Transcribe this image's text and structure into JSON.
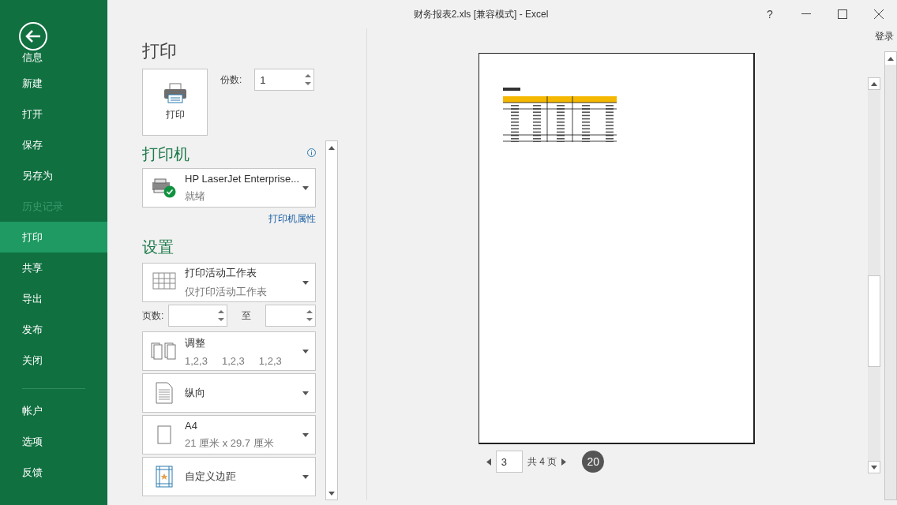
{
  "window": {
    "title": "财务报表2.xls  [兼容模式] - Excel",
    "help": "?",
    "sign_in": "登录"
  },
  "sidebar": {
    "items": [
      {
        "label": "信息",
        "selected": false,
        "disabled": false
      },
      {
        "label": "新建",
        "selected": false,
        "disabled": false
      },
      {
        "label": "打开",
        "selected": false,
        "disabled": false
      },
      {
        "label": "保存",
        "selected": false,
        "disabled": false
      },
      {
        "label": "另存为",
        "selected": false,
        "disabled": false
      },
      {
        "label": "历史记录",
        "selected": false,
        "disabled": true
      },
      {
        "label": "打印",
        "selected": true,
        "disabled": false
      },
      {
        "label": "共享",
        "selected": false,
        "disabled": false
      },
      {
        "label": "导出",
        "selected": false,
        "disabled": false
      },
      {
        "label": "发布",
        "selected": false,
        "disabled": false
      },
      {
        "label": "关闭",
        "selected": false,
        "disabled": false
      }
    ],
    "footer_items": [
      {
        "label": "帐户",
        "selected": false,
        "disabled": false
      },
      {
        "label": "选项",
        "selected": false,
        "disabled": false
      },
      {
        "label": "反馈",
        "selected": false,
        "disabled": false
      }
    ]
  },
  "print": {
    "heading": "打印",
    "button": "打印",
    "copies_label": "份数:",
    "copies": "1"
  },
  "printer": {
    "heading": "打印机",
    "name": "HP LaserJet Enterprise...",
    "status": "就绪",
    "properties_link": "打印机属性"
  },
  "settings": {
    "heading": "设置",
    "options": [
      {
        "kind": "sheet",
        "title": "打印活动工作表",
        "details": [
          "仅打印活动工作表"
        ]
      },
      {
        "kind": "pages",
        "label": "页数:",
        "to": "至"
      },
      {
        "kind": "collate",
        "title": "调整",
        "details": [
          "1,2,3",
          "1,2,3",
          "1,2,3"
        ]
      },
      {
        "kind": "orientation",
        "title": "纵向"
      },
      {
        "kind": "paper",
        "title": "A4",
        "details": [
          "21 厘米 x 29.7 厘米"
        ]
      },
      {
        "kind": "margins",
        "title": "自定义边距"
      }
    ]
  },
  "pager": {
    "current": "3",
    "total": "共 4 页",
    "badge": "20"
  }
}
